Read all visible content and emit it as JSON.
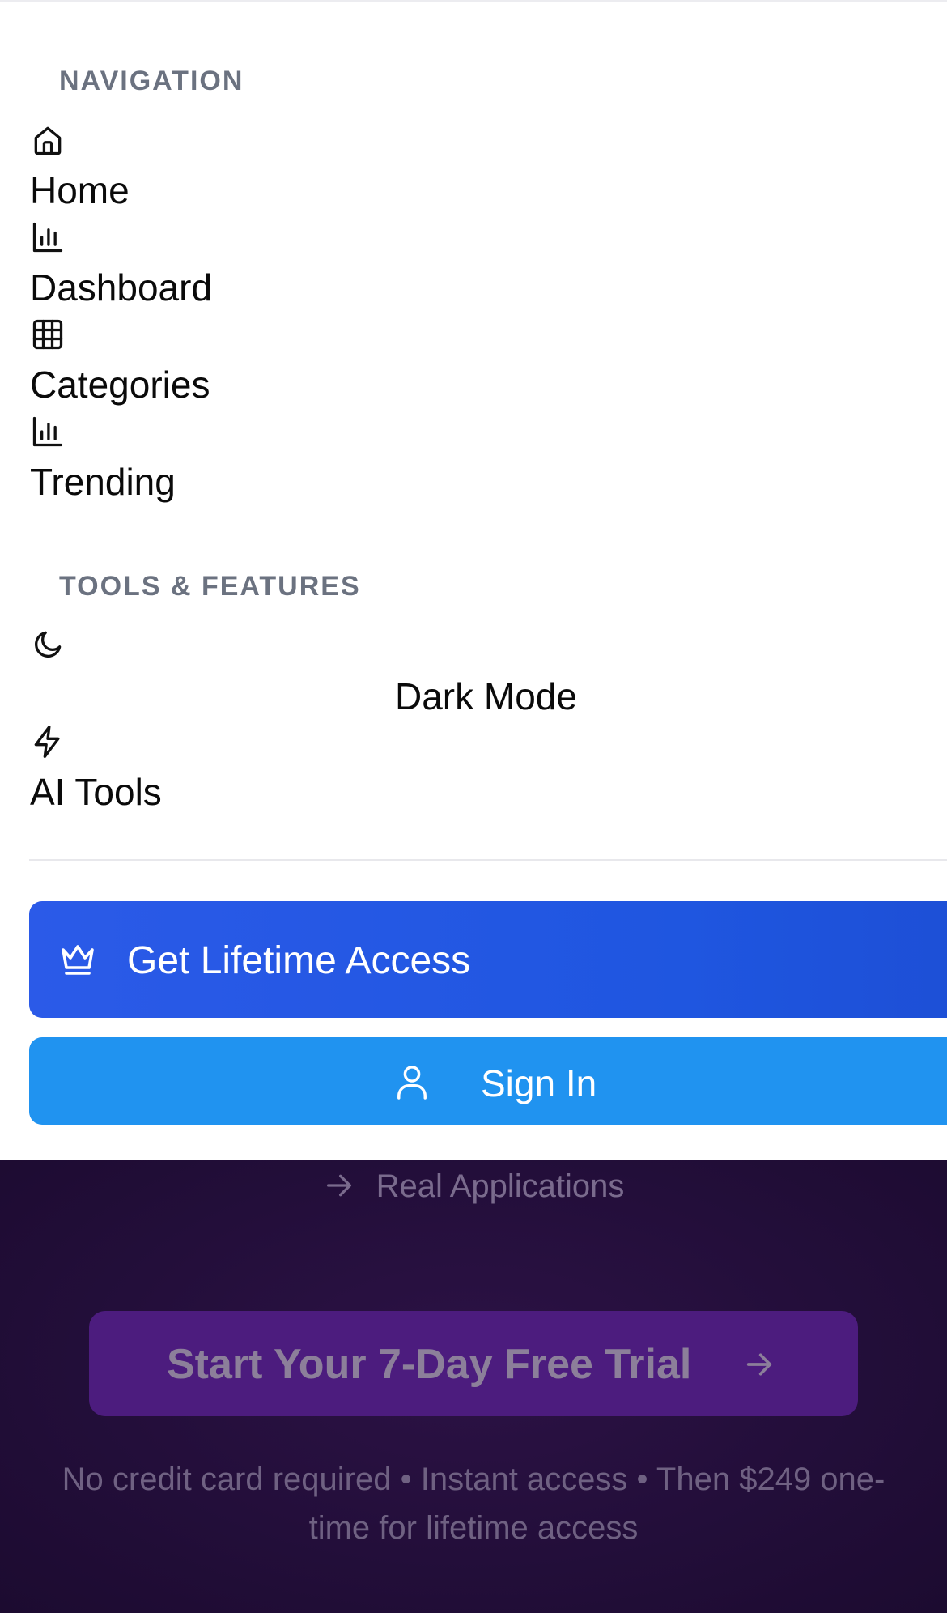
{
  "menu": {
    "navigation_heading": "NAVIGATION",
    "nav_items": [
      {
        "label": "Home",
        "icon": "home-icon"
      },
      {
        "label": "Dashboard",
        "icon": "bar-chart-icon"
      },
      {
        "label": "Categories",
        "icon": "grid-icon"
      },
      {
        "label": "Trending",
        "icon": "bar-chart-icon"
      }
    ],
    "tools_heading": "TOOLS & FEATURES",
    "tool_items": [
      {
        "label": "Dark Mode",
        "icon": "moon-icon"
      },
      {
        "label": "AI Tools",
        "icon": "lightning-icon"
      }
    ],
    "lifetime_button": {
      "label": "Get Lifetime Access",
      "icon": "crown-icon"
    },
    "signin_button": {
      "label": "Sign In",
      "icon": "user-icon"
    }
  },
  "hero": {
    "feature_line": {
      "label": "Real Applications",
      "icon": "arrow-right-icon"
    },
    "trial_button": {
      "label": "Start Your 7-Day Free Trial",
      "icon": "arrow-right-icon"
    },
    "fineprint": "No credit card required • Instant access • Then $249 one-time for lifetime access"
  },
  "colors": {
    "primary_blue": "#2b5ae8",
    "signin_blue": "#2093f0",
    "hero_background": "#230e3a",
    "trial_purple": "#4c1c7e",
    "heading_gray": "#6b7280"
  }
}
